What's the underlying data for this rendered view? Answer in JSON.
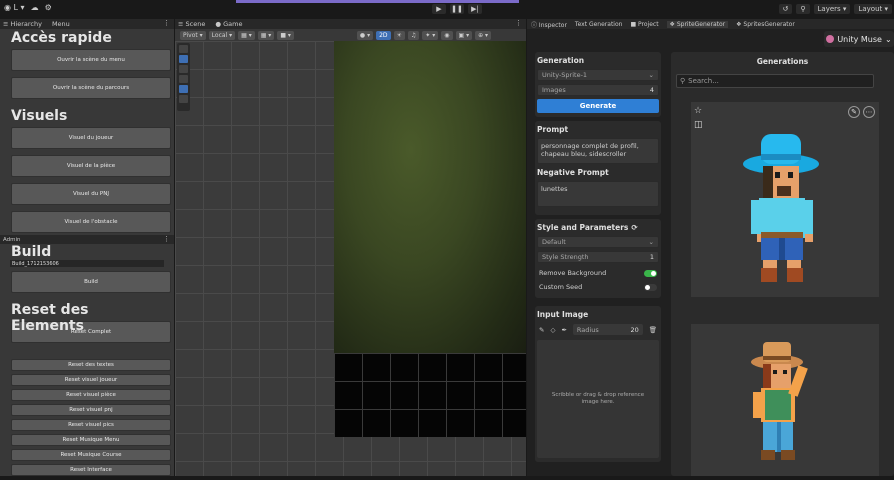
{
  "topbar": {
    "account_label": "L",
    "layers_label": "Layers",
    "layout_label": "Layout"
  },
  "hierarchy": {
    "tabs": [
      "Hierarchy",
      "Menu"
    ],
    "quick_title": "Accès rapide",
    "quick_buttons": [
      "Ouvrir la scène du menu",
      "Ouvrir la scène du parcours"
    ],
    "visuals_title": "Visuels",
    "visual_buttons": [
      "Visuel du joueur",
      "Visuel de la pièce",
      "Visuel du PNJ",
      "Visuel de l'obstacle"
    ],
    "admin_label": "Admin",
    "build_title": "Build",
    "build_field": "Build_1712153606",
    "build_button": "Build",
    "reset_title": "Reset des Elements",
    "reset_complete": "Reset Complet",
    "reset_buttons": [
      "Reset des textes",
      "Reset visuel joueur",
      "Reset visuel pièce",
      "Reset visuel pnj",
      "Reset visuel pics",
      "Reset Musique Menu",
      "Reset Musique Course",
      "Reset Interface"
    ]
  },
  "scene": {
    "tabs": [
      "Scene",
      "Game"
    ],
    "pivot_label": "Pivot",
    "local_label": "Local",
    "mode_2d": "2D"
  },
  "inspector": {
    "tabs": [
      "Inspector",
      "Text Generation",
      "Project",
      "SpriteGenerator",
      "SpritesGenerator"
    ],
    "muse_label": "Unity Muse",
    "generation_title": "Generation",
    "model_value": "Unity-Sprite-1",
    "images_label": "Images",
    "images_value": "4",
    "generate_button": "Generate",
    "prompt_title": "Prompt",
    "prompt_value": "personnage complet de profil, chapeau bleu, sidescroller",
    "negative_title": "Negative Prompt",
    "negative_value": "lunettes",
    "style_title": "Style and Parameters",
    "style_value": "Default",
    "strength_label": "Style Strength",
    "strength_value": "1",
    "remove_bg_label": "Remove Background",
    "remove_bg_on": true,
    "custom_seed_label": "Custom Seed",
    "custom_seed_on": false,
    "input_title": "Input Image",
    "radius_label": "Radius",
    "radius_value": "20",
    "dropzone_text": "Scribble or drag & drop reference image here."
  },
  "gallery": {
    "title": "Generations",
    "search_placeholder": "Search..."
  }
}
